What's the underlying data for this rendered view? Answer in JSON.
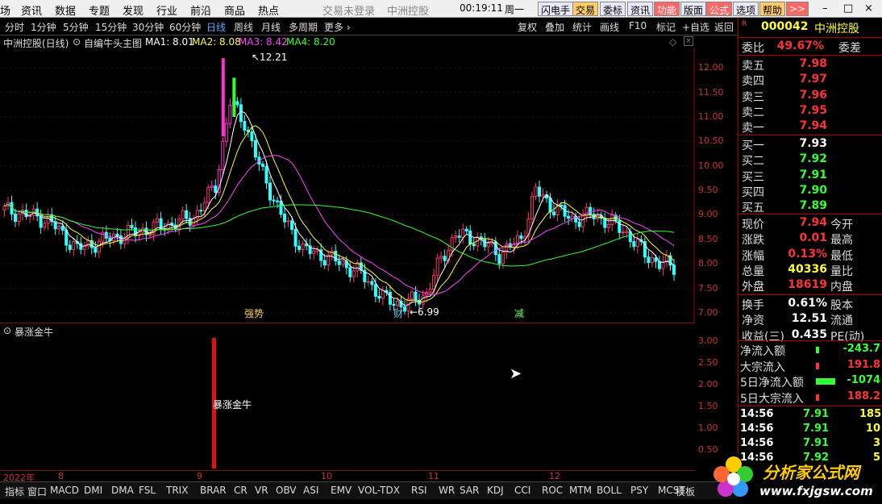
{
  "menubar": {
    "items": [
      "场",
      "资讯",
      "数据",
      "专题",
      "发现",
      "行业",
      "前沿",
      "商品",
      "热点"
    ],
    "login_text": "交易未登录",
    "stock_title": "中洲控股",
    "clock": "00:19:11",
    "weekday": "周一",
    "buttons": [
      "闪电手",
      "交易",
      "委标",
      "资讯",
      "功能",
      "版面",
      "公式",
      "选项",
      "帮助",
      ">>"
    ],
    "window_controls": [
      "–",
      "□",
      "×"
    ]
  },
  "periods": [
    "分时",
    "1分钟",
    "5分钟",
    "15分钟",
    "30分钟",
    "60分钟",
    "日线",
    "周线",
    "月线",
    "多周期",
    "更多 ›"
  ],
  "active_period": "日线",
  "toolbar_right": [
    "复权",
    "叠加",
    "统计",
    "画线",
    "F10",
    "标记",
    "+自选",
    "返回"
  ],
  "info": {
    "stock_name": "中洲控股(日线)",
    "template": "自编牛头主图",
    "ma1": "MA1: 8.01",
    "ma2": "MA2: 8.08",
    "ma3": "MA3: 8.42",
    "ma4": "MA4: 8.20"
  },
  "annotations": {
    "high": "12.21",
    "low": "6.99",
    "tag1": "强势",
    "tag2": "财",
    "tag3": "减"
  },
  "indicator": {
    "name": "暴涨金牛",
    "label": "暴涨金牛",
    "axis": [
      "3.00",
      "2.50",
      "2.00",
      "1.50",
      "1.00",
      "0.50"
    ]
  },
  "price_axis": [
    "12.00",
    "11.50",
    "11.00",
    "10.50",
    "10.00",
    "9.50",
    "9.00",
    "8.50",
    "8.00",
    "7.50",
    "7.00"
  ],
  "dates": [
    "2022年",
    "8",
    "9",
    "10",
    "11",
    "12"
  ],
  "tabs": [
    "指标",
    "窗口",
    "MACD",
    "DMI",
    "DMA",
    "FSL",
    "TRIX",
    "BRAR",
    "CR",
    "VR",
    "OBV",
    "ASI",
    "EMV",
    "VOL-TDX",
    "RSI",
    "WR",
    "SAR",
    "KDJ",
    "CCI",
    "ROC",
    "MTM",
    "BOLL",
    "PSY",
    "MCST"
  ],
  "tab_right": "模板",
  "quote": {
    "code": "000042",
    "name": "中洲控股",
    "weibi_label": "委比",
    "weibi": "49.67%",
    "weicha_label": "委差",
    "asks": [
      {
        "label": "卖五",
        "price": "7.98"
      },
      {
        "label": "卖四",
        "price": "7.97"
      },
      {
        "label": "卖三",
        "price": "7.96"
      },
      {
        "label": "卖二",
        "price": "7.95"
      },
      {
        "label": "卖一",
        "price": "7.94"
      }
    ],
    "bids": [
      {
        "label": "买一",
        "price": "7.93"
      },
      {
        "label": "买二",
        "price": "7.92"
      },
      {
        "label": "买三",
        "price": "7.91"
      },
      {
        "label": "买四",
        "price": "7.90"
      },
      {
        "label": "买五",
        "price": "7.89"
      }
    ],
    "stats": [
      {
        "l1": "现价",
        "v": "7.94",
        "l2": "今开",
        "c": "#ff3333"
      },
      {
        "l1": "涨跌",
        "v": "0.01",
        "l2": "最高",
        "c": "#ff3333"
      },
      {
        "l1": "涨幅",
        "v": "0.13%",
        "l2": "最低",
        "c": "#ff3333"
      },
      {
        "l1": "总量",
        "v": "40336",
        "l2": "量比",
        "c": "#ffff33"
      },
      {
        "l1": "外盘",
        "v": "18619",
        "l2": "内盘",
        "c": "#ff3333"
      }
    ],
    "stats2": [
      {
        "l1": "换手",
        "v": "0.61%",
        "l2": "股本",
        "c": "#ffffff"
      },
      {
        "l1": "净资",
        "v": "12.51",
        "l2": "流通",
        "c": "#ffffff"
      },
      {
        "l1": "收益(三)",
        "v": "0.435",
        "l2": "PE(动)",
        "c": "#ffffff"
      }
    ],
    "flows": [
      {
        "l": "净流入额",
        "v": "-243.7",
        "c": "#33ff33"
      },
      {
        "l": "大宗流入",
        "v": "191.8",
        "c": "#ff3333"
      },
      {
        "l": "5日净流入额",
        "v": "-1074",
        "c": "#33ff33"
      },
      {
        "l": "5日大宗流入",
        "v": "188.2",
        "c": "#ff3333"
      }
    ],
    "ticks": [
      {
        "t": "14:56",
        "p": "7.91",
        "v": "185"
      },
      {
        "t": "14:56",
        "p": "7.91",
        "v": "10"
      },
      {
        "t": "14:56",
        "p": "7.91",
        "v": "3"
      },
      {
        "t": "14:56",
        "p": "7.92",
        "v": "5"
      }
    ]
  },
  "logo": {
    "title": "分析家公式网",
    "url": "www.fxjgsw.com"
  },
  "colors": {
    "up": "#ff3366",
    "down": "#33ffff",
    "ma1": "#ffffff",
    "ma2": "#ffff33",
    "ma3": "#ff44ff",
    "ma4": "#33ff33"
  }
}
